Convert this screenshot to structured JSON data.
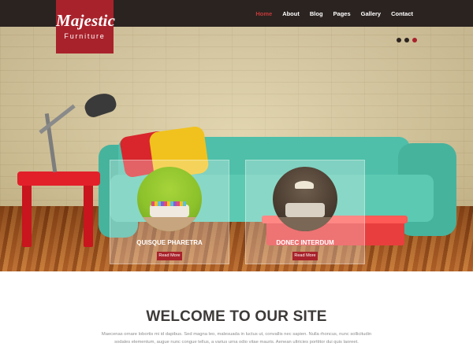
{
  "brand": {
    "name": "Majestic",
    "tagline": "Furniture",
    "colors": {
      "accent": "#a8222b",
      "header_bg": "#2b2320",
      "nav_active": "#c43a3a"
    }
  },
  "nav": {
    "items": [
      {
        "label": "Home",
        "active": true
      },
      {
        "label": "About"
      },
      {
        "label": "Blog"
      },
      {
        "label": "Pages"
      },
      {
        "label": "Gallery"
      },
      {
        "label": "Contact"
      }
    ]
  },
  "slider": {
    "dots": 3,
    "active_dot": 3,
    "cards": [
      {
        "title": "QUISQUE PHARETRA",
        "button": "Read More"
      },
      {
        "title": "DONEC INTERDUM",
        "button": "Read More"
      }
    ]
  },
  "welcome": {
    "title": "WELCOME TO OUR SITE",
    "line1": "Maecenas ornare lobortis mi id dapibus. Sed magna leo, malesuada in luctus ut, convallis nec sapien. Nulla rhoncus, nunc sollicitudin",
    "line2": "sodales elementum, augue nunc congue tellus, a varius urna odio vitae mauris. Aenean ultricies porttitor dui quis laoreet."
  }
}
